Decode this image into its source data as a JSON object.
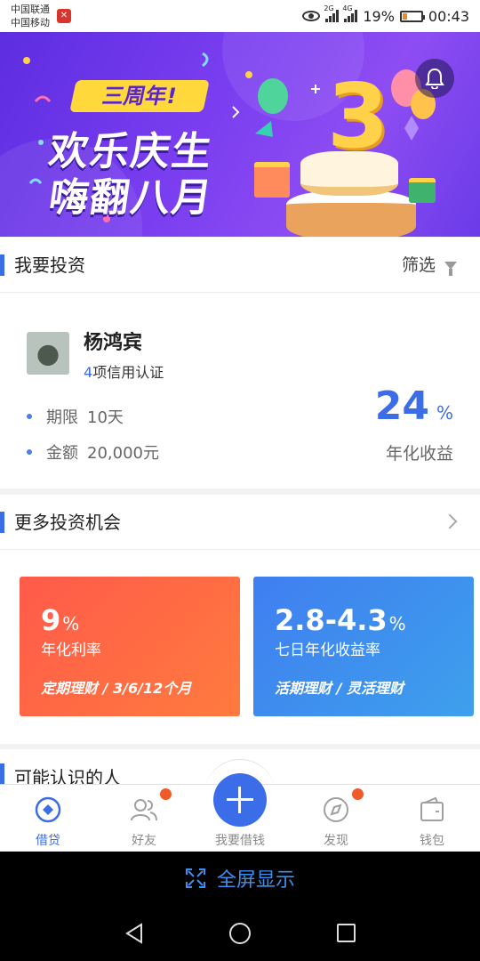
{
  "status_bar": {
    "carrier1": "中国联通",
    "carrier2": "中国移动",
    "net1": "2G",
    "net2": "4G",
    "battery": "19%",
    "time": "00:43"
  },
  "banner": {
    "tag": "三周年!",
    "line1": "欢乐庆生",
    "line2": "嗨翻八月",
    "cake_number": "3",
    "slide_count": 3,
    "active_slide": 1
  },
  "invest": {
    "title": "我要投资",
    "filter_label": "筛选",
    "investor": {
      "name": "杨鸿宾",
      "cert_count": "4",
      "cert_text": "项信用认证",
      "term_label": "期限",
      "term_value": "10天",
      "amount_label": "金额",
      "amount_value": "20,000元",
      "rate": "24",
      "rate_unit": "%",
      "rate_label": "年化收益"
    }
  },
  "more": {
    "title": "更多投资机会",
    "cards": [
      {
        "value": "9",
        "unit": "%",
        "label": "年化利率",
        "tags": "定期理财   /   3/6/12个月"
      },
      {
        "value": "2.8-4.3",
        "unit": "%",
        "label": "七日年化收益率",
        "tags": "活期理财   /   灵活理财"
      }
    ]
  },
  "people": {
    "title": "可能认识的人"
  },
  "tabs": [
    {
      "label": "借贷",
      "icon": "loan-icon"
    },
    {
      "label": "好友",
      "icon": "friends-icon"
    },
    {
      "label": "我要借钱",
      "icon": "plus-icon"
    },
    {
      "label": "发现",
      "icon": "compass-icon"
    },
    {
      "label": "钱包",
      "icon": "wallet-icon"
    }
  ],
  "fullscreen": {
    "label": "全屏显示"
  },
  "colors": {
    "accent": "#3b6de8",
    "badge": "#f05a28",
    "card_red": "#ff5a4a",
    "card_blue": "#3f7ef0"
  }
}
